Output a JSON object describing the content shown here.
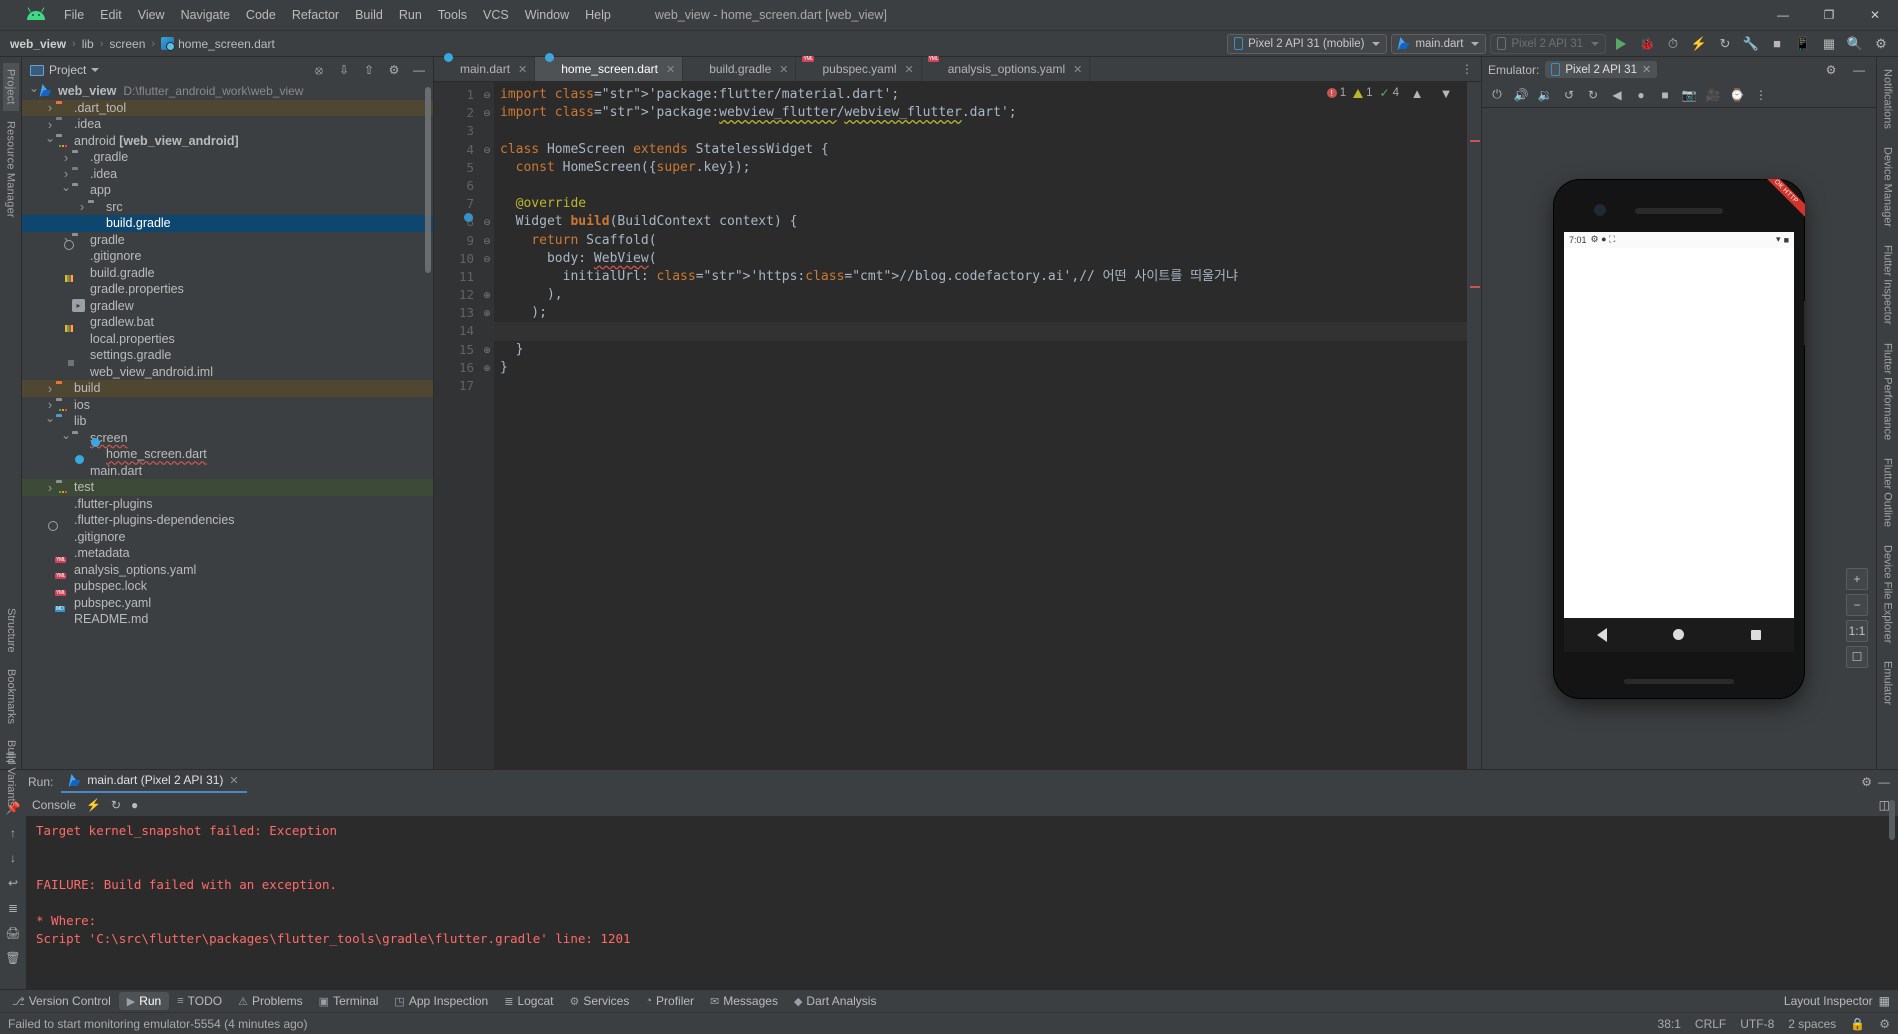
{
  "window": {
    "title": "web_view - home_screen.dart [web_view]",
    "minimize": "—",
    "maximize": "❐",
    "close": "✕"
  },
  "menu": {
    "items": [
      "File",
      "Edit",
      "View",
      "Navigate",
      "Code",
      "Refactor",
      "Build",
      "Run",
      "Tools",
      "VCS",
      "Window",
      "Help"
    ]
  },
  "breadcrumb": {
    "items": [
      "web_view",
      "lib",
      "screen",
      "home_screen.dart"
    ],
    "separator": "›"
  },
  "run_config": {
    "device": "Pixel 2 API 31 (mobile)",
    "config": "main.dart",
    "attached_device": "Pixel 2 API 31"
  },
  "project_panel": {
    "title": "Project",
    "tree": [
      {
        "depth": 0,
        "arrow": "v",
        "icon": "flutter",
        "label": "web_view",
        "bold": true,
        "note": "D:\\flutter_android_work\\web_view",
        "state": "none"
      },
      {
        "depth": 1,
        "arrow": ">",
        "icon": "folder-orange",
        "label": ".dart_tool",
        "state": "brown"
      },
      {
        "depth": 1,
        "arrow": ">",
        "icon": "folder-idea",
        "label": ".idea",
        "state": "none"
      },
      {
        "depth": 1,
        "arrow": "v",
        "icon": "folder-module",
        "label": "android [web_view_android]",
        "boldPart": "[web_view_android]",
        "state": "none"
      },
      {
        "depth": 2,
        "arrow": ">",
        "icon": "folder",
        "label": ".gradle",
        "state": "none"
      },
      {
        "depth": 2,
        "arrow": ">",
        "icon": "folder-idea",
        "label": ".idea",
        "state": "none"
      },
      {
        "depth": 2,
        "arrow": "v",
        "icon": "folder",
        "label": "app",
        "state": "none"
      },
      {
        "depth": 3,
        "arrow": ">",
        "icon": "folder",
        "label": "src",
        "state": "none"
      },
      {
        "depth": 3,
        "arrow": "",
        "icon": "gradle",
        "label": "build.gradle",
        "state": "selected"
      },
      {
        "depth": 2,
        "arrow": ">",
        "icon": "folder",
        "label": "gradle",
        "state": "none"
      },
      {
        "depth": 2,
        "arrow": "",
        "icon": "gitignore",
        "label": ".gitignore",
        "state": "none"
      },
      {
        "depth": 2,
        "arrow": "",
        "icon": "gradle",
        "label": "build.gradle",
        "state": "none"
      },
      {
        "depth": 2,
        "arrow": "",
        "icon": "properties",
        "label": "gradle.properties",
        "state": "none"
      },
      {
        "depth": 2,
        "arrow": "",
        "icon": "exe",
        "label": "gradlew",
        "state": "none"
      },
      {
        "depth": 2,
        "arrow": "",
        "icon": "bat",
        "label": "gradlew.bat",
        "state": "none"
      },
      {
        "depth": 2,
        "arrow": "",
        "icon": "properties",
        "label": "local.properties",
        "state": "none"
      },
      {
        "depth": 2,
        "arrow": "",
        "icon": "gradle",
        "label": "settings.gradle",
        "state": "none"
      },
      {
        "depth": 2,
        "arrow": "",
        "icon": "iml",
        "label": "web_view_android.iml",
        "state": "none"
      },
      {
        "depth": 1,
        "arrow": ">",
        "icon": "folder-build",
        "label": "build",
        "state": "brown"
      },
      {
        "depth": 1,
        "arrow": ">",
        "icon": "folder-module",
        "label": "ios",
        "state": "none"
      },
      {
        "depth": 1,
        "arrow": "v",
        "icon": "folder-blue",
        "label": "lib",
        "state": "none"
      },
      {
        "depth": 2,
        "arrow": "v",
        "icon": "folder",
        "label": "screen",
        "state": "none",
        "squiggle": true
      },
      {
        "depth": 3,
        "arrow": "",
        "icon": "dart",
        "label": "home_screen.dart",
        "state": "none",
        "squiggle": true
      },
      {
        "depth": 2,
        "arrow": "",
        "icon": "dart",
        "label": "main.dart",
        "state": "none"
      },
      {
        "depth": 1,
        "arrow": ">",
        "icon": "folder-test",
        "label": "test",
        "state": "green"
      },
      {
        "depth": 1,
        "arrow": "",
        "icon": "doc",
        "label": ".flutter-plugins",
        "state": "none"
      },
      {
        "depth": 1,
        "arrow": "",
        "icon": "doc",
        "label": ".flutter-plugins-dependencies",
        "state": "none"
      },
      {
        "depth": 1,
        "arrow": "",
        "icon": "gitignore",
        "label": ".gitignore",
        "state": "none"
      },
      {
        "depth": 1,
        "arrow": "",
        "icon": "doc",
        "label": ".metadata",
        "state": "none"
      },
      {
        "depth": 1,
        "arrow": "",
        "icon": "yml",
        "label": "analysis_options.yaml",
        "state": "none"
      },
      {
        "depth": 1,
        "arrow": "",
        "icon": "yml",
        "label": "pubspec.lock",
        "state": "none"
      },
      {
        "depth": 1,
        "arrow": "",
        "icon": "yml",
        "label": "pubspec.yaml",
        "state": "none"
      },
      {
        "depth": 1,
        "arrow": "",
        "icon": "md",
        "label": "README.md",
        "state": "none"
      }
    ]
  },
  "left_rail": {
    "items": [
      "Project",
      "Resource Manager"
    ]
  },
  "right_rail": {
    "items": [
      "Notifications",
      "Device Manager",
      "Flutter Inspector",
      "Flutter Performance",
      "Flutter Outline",
      "Device File Explorer",
      "Emulator"
    ]
  },
  "bottom_rail": {
    "items": [
      "Structure",
      "Bookmarks",
      "Build Variants"
    ]
  },
  "editor": {
    "tabs": [
      {
        "label": "main.dart",
        "icon": "dart",
        "active": false
      },
      {
        "label": "home_screen.dart",
        "icon": "dart",
        "active": true
      },
      {
        "label": "build.gradle",
        "icon": "gradle",
        "active": false
      },
      {
        "label": "pubspec.yaml",
        "icon": "yml",
        "active": false
      },
      {
        "label": "analysis_options.yaml",
        "icon": "yml",
        "active": false
      }
    ],
    "analysis": {
      "errors": "1",
      "warnings": "1",
      "checks": "4"
    },
    "line_numbers": [
      "1",
      "2",
      "3",
      "4",
      "5",
      "6",
      "7",
      "8",
      "9",
      "10",
      "11",
      "12",
      "13",
      "14",
      "15",
      "16",
      "17"
    ],
    "code_lines": [
      "import 'package:flutter/material.dart';",
      "import 'package:webview_flutter/webview_flutter.dart';",
      "",
      "class HomeScreen extends StatelessWidget {",
      "  const HomeScreen({super.key});",
      "",
      "  @override",
      "  Widget build(BuildContext context) {",
      "    return Scaffold(",
      "      body: WebView(",
      "        initialUrl: 'https://blog.codefactory.ai',// 어떤 사이트를 띄울거냐",
      "      ),",
      "    );",
      "",
      "  }",
      "}",
      ""
    ]
  },
  "emulator": {
    "label": "Emulator:",
    "tab": "Pixel 2 API 31",
    "device_time": "7:01",
    "zoom_reset": "1:1",
    "zoom_in": "+",
    "zoom_out": "−",
    "ribbon": "OK HTTP"
  },
  "run_panel": {
    "label": "Run:",
    "tab": "main.dart (Pixel 2 API 31)",
    "console_tab": "Console",
    "console_lines": [
      "Target kernel_snapshot failed: Exception",
      "",
      "",
      "FAILURE: Build failed with an exception.",
      "",
      "* Where:",
      "Script 'C:\\src\\flutter\\packages\\flutter_tools\\gradle\\flutter.gradle' line: 1201"
    ]
  },
  "bottom_windows": {
    "items": [
      {
        "label": "Version Control",
        "icon": "⎇",
        "active": false
      },
      {
        "label": "Run",
        "icon": "▶",
        "active": true
      },
      {
        "label": "TODO",
        "icon": "≡",
        "active": false
      },
      {
        "label": "Problems",
        "icon": "⚠",
        "active": false
      },
      {
        "label": "Terminal",
        "icon": "▣",
        "active": false
      },
      {
        "label": "App Inspection",
        "icon": "◳",
        "active": false
      },
      {
        "label": "Logcat",
        "icon": "≣",
        "active": false
      },
      {
        "label": "Services",
        "icon": "⚙",
        "active": false
      },
      {
        "label": "Profiler",
        "icon": "◔",
        "active": false
      },
      {
        "label": "Messages",
        "icon": "✉",
        "active": false
      },
      {
        "label": "Dart Analysis",
        "icon": "◆",
        "active": false
      }
    ],
    "layout_inspector": "Layout Inspector"
  },
  "status_bar": {
    "message": "Failed to start monitoring emulator-5554 (4 minutes ago)",
    "caret": "38:1",
    "line_sep": "CRLF",
    "encoding": "UTF-8",
    "indent": "2 spaces",
    "lock": "ὑ2",
    "branch": "⎇"
  },
  "colors": {
    "accent_blue": "#4a88c7",
    "selection": "#0d466f",
    "error_red": "#c75450",
    "warn_yellow": "#bbb529",
    "ok_green": "#59a869",
    "string_green": "#6a8759",
    "keyword_orange": "#cc7832",
    "editor_bg": "#2b2b2b",
    "panel_bg": "#3c3f41"
  }
}
